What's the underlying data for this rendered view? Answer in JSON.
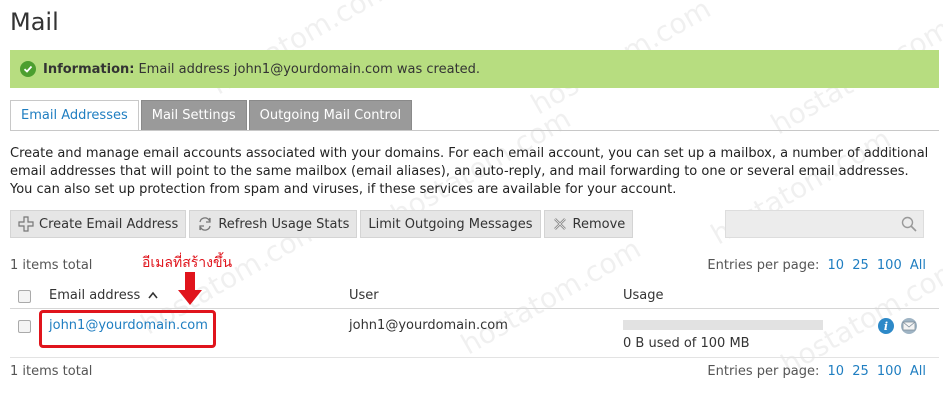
{
  "page": {
    "title": "Mail"
  },
  "notification": {
    "label": "Information:",
    "message": "Email address john1@yourdomain.com was created."
  },
  "tabs": [
    {
      "label": "Email Addresses",
      "active": true
    },
    {
      "label": "Mail Settings",
      "active": false
    },
    {
      "label": "Outgoing Mail Control",
      "active": false
    }
  ],
  "description": "Create and manage email accounts associated with your domains. For each email account, you can set up a mailbox, a number of additional email addresses that will point to the same mailbox (email aliases), an auto-reply, and mail forwarding to one or several email addresses. You can also set up protection from spam and viruses, if these services are available for your account.",
  "toolbar": {
    "create_label": "Create Email Address",
    "refresh_label": "Refresh Usage Stats",
    "limit_label": "Limit Outgoing Messages",
    "remove_label": "Remove"
  },
  "list": {
    "items_total": "1 items total",
    "entries_label": "Entries per page:",
    "page_sizes": [
      "10",
      "25",
      "100",
      "All"
    ],
    "columns": {
      "email": "Email address",
      "user": "User",
      "usage": "Usage"
    },
    "rows": [
      {
        "email": "john1@yourdomain.com",
        "user": "john1@yourdomain.com",
        "usage_text": "0 B used of 100 MB",
        "usage_fraction": 0
      }
    ]
  },
  "annotation": {
    "text": "อีเมลที่สร้างขึ้น"
  },
  "watermark": "hostatom.com",
  "colors": {
    "accent": "#1f7ec1",
    "info_bg": "#b7dd80",
    "annotation": "#e0141c"
  }
}
